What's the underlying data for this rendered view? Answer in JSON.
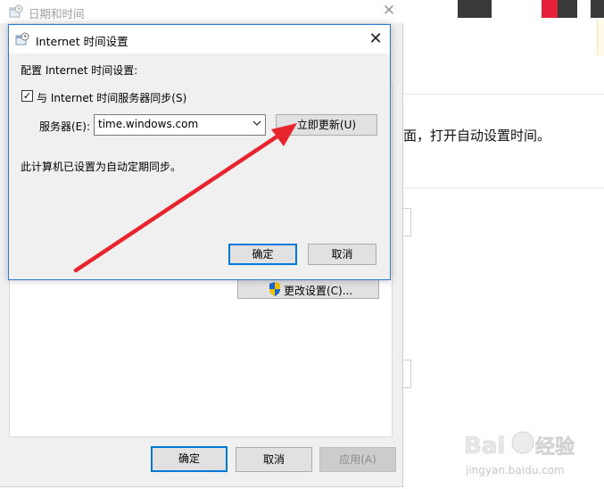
{
  "background_page": {
    "description_text": "面，打开自动设置时间。"
  },
  "outer_window": {
    "title": "日期和时间",
    "close_glyph": "✕",
    "change_settings_label": "更改设置(C)...",
    "ok_label": "确定",
    "cancel_label": "取消",
    "apply_label": "应用(A)"
  },
  "internet_time_dialog": {
    "title": "Internet 时间设置",
    "close_glyph": "✕",
    "configure_label": "配置 Internet 时间设置:",
    "sync_checkbox_label": "与 Internet 时间服务器同步(S)",
    "sync_checked": true,
    "server_label": "服务器(E):",
    "server_value": "time.windows.com",
    "update_now_label": "立即更新(U)",
    "status_text": "此计算机已设置为自动定期同步。",
    "ok_label": "确定",
    "cancel_label": "取消"
  },
  "watermark": {
    "logo": "Baidu经验",
    "url": "jingyan.baidu.com"
  },
  "colors": {
    "accent_blue": "#0078d7",
    "annotation_red": "#e8252f",
    "uac_shield_blue": "#1f64c8",
    "uac_shield_yellow": "#f2c200"
  }
}
